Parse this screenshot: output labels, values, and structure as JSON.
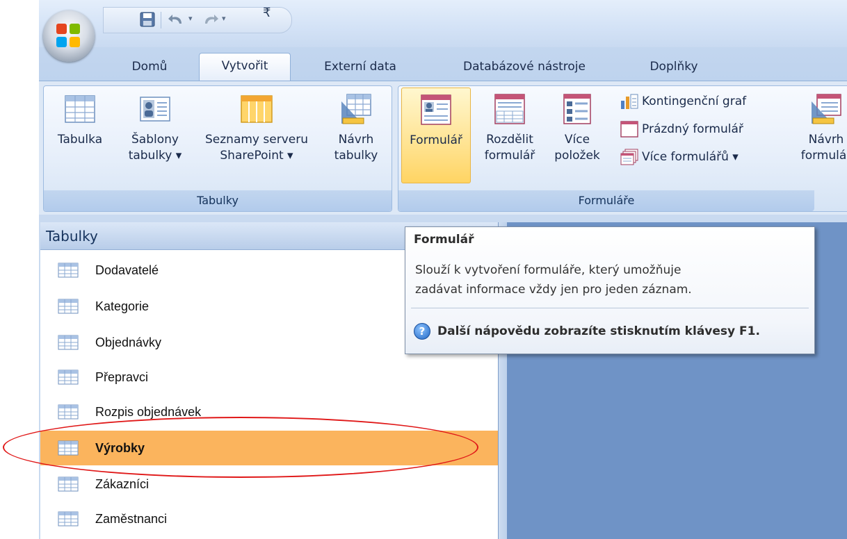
{
  "quick_access": {
    "save_icon": "save-icon",
    "undo_icon": "undo-icon",
    "redo_icon": "redo-icon",
    "customize": "₹"
  },
  "tabs": [
    {
      "label": "Domů"
    },
    {
      "label": "Vytvořit",
      "active": true
    },
    {
      "label": "Externí data"
    },
    {
      "label": "Databázové nástroje"
    },
    {
      "label": "Doplňky"
    }
  ],
  "ribbon": {
    "tables_group": {
      "label": "Tabulky",
      "buttons": [
        {
          "line1": "Tabulka",
          "line2": ""
        },
        {
          "line1": "Šablony",
          "line2": "tabulky ▾"
        },
        {
          "line1": "Seznamy serveru",
          "line2": "SharePoint ▾"
        },
        {
          "line1": "Návrh",
          "line2": "tabulky"
        }
      ]
    },
    "forms_group": {
      "label": "Formuláře",
      "buttons": [
        {
          "line1": "Formulář",
          "line2": ""
        },
        {
          "line1": "Rozdělit",
          "line2": "formulář"
        },
        {
          "line1": "Více",
          "line2": "položek"
        },
        {
          "line1": "Návrh",
          "line2": "formulář"
        }
      ],
      "small": [
        {
          "label": "Kontingenční graf"
        },
        {
          "label": "Prázdný formulář"
        },
        {
          "label": "Více formulářů ▾"
        }
      ]
    }
  },
  "nav_pane": {
    "header": "Tabulky",
    "items": [
      {
        "label": "Dodavatelé"
      },
      {
        "label": "Kategorie"
      },
      {
        "label": "Objednávky"
      },
      {
        "label": "Přepravci"
      },
      {
        "label": "Rozpis objednávek"
      },
      {
        "label": "Výrobky",
        "selected": true
      },
      {
        "label": "Zákazníci"
      },
      {
        "label": "Zaměstnanci"
      }
    ]
  },
  "tooltip": {
    "title": "Formulář",
    "line1": "Slouží k vytvoření formuláře, který umožňuje",
    "line2": "zadávat informace vždy jen pro jeden záznam.",
    "help": "Další nápovědu zobrazíte stisknutím klávesy F1."
  },
  "colors": {
    "selected_row": "#fbb45d",
    "highlight_button": "#ffd463",
    "annotation_circle": "#e01818",
    "workspace": "#6f93c6"
  }
}
